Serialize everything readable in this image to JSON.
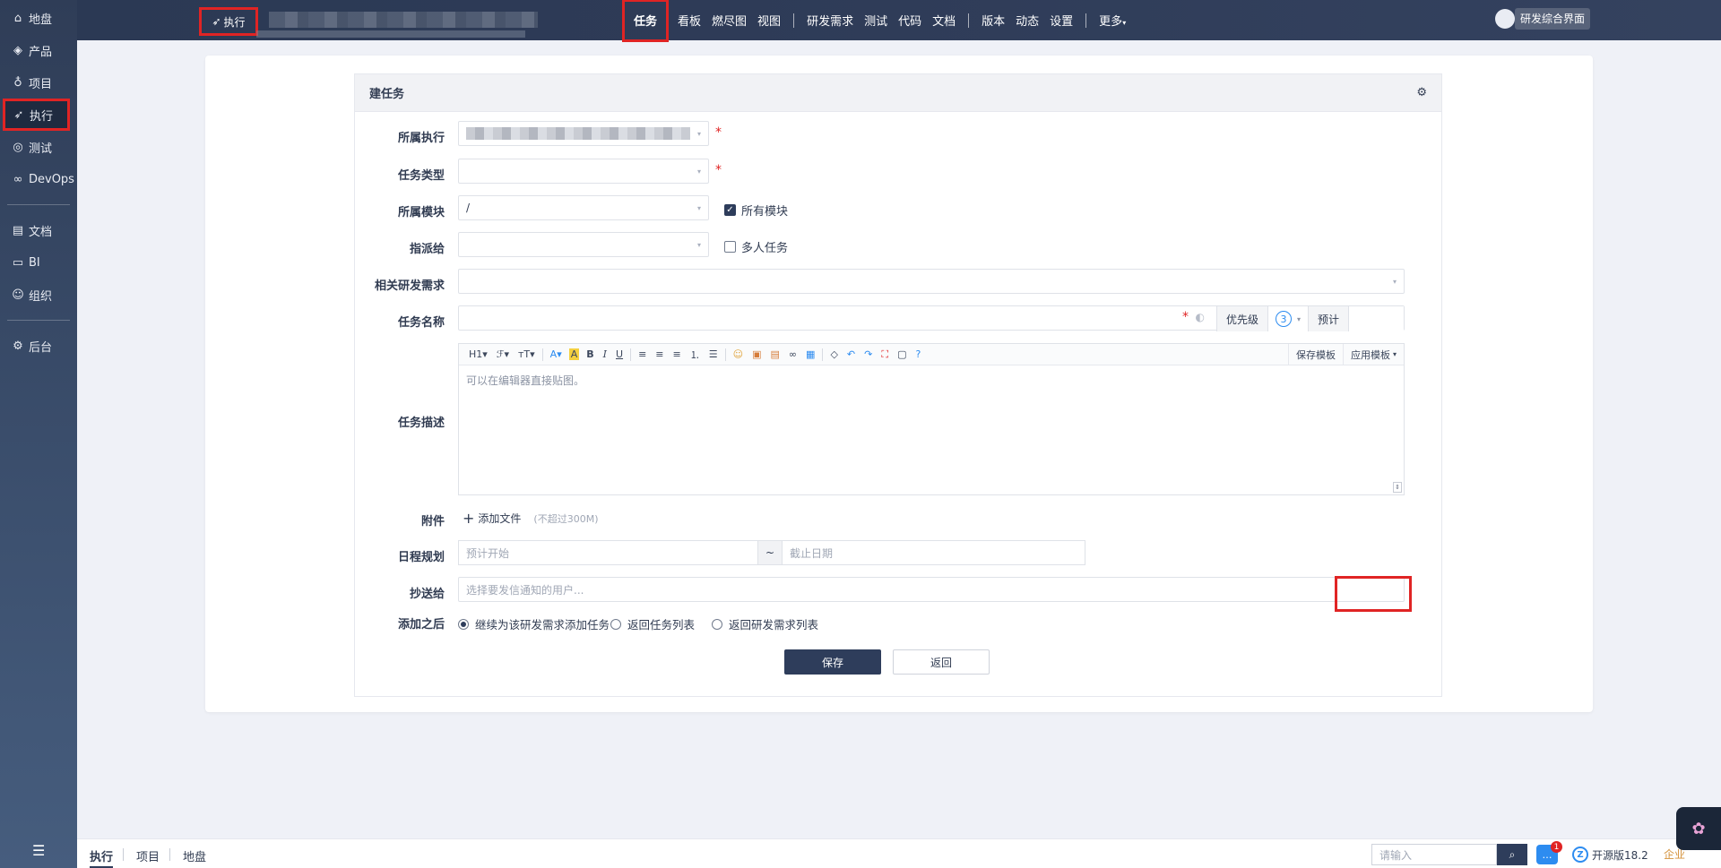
{
  "sidebar": {
    "items": [
      {
        "label": "地盘",
        "icon": "home-icon"
      },
      {
        "label": "产品",
        "icon": "product-icon"
      },
      {
        "label": "项目",
        "icon": "project-icon"
      },
      {
        "label": "执行",
        "icon": "run-icon"
      },
      {
        "label": "测试",
        "icon": "test-icon"
      },
      {
        "label": "DevOps",
        "icon": "devops-icon"
      },
      {
        "label": "文档",
        "icon": "doc-icon"
      },
      {
        "label": "BI",
        "icon": "bi-icon"
      },
      {
        "label": "组织",
        "icon": "org-icon"
      },
      {
        "label": "后台",
        "icon": "admin-icon"
      }
    ]
  },
  "header": {
    "breadcrumb": "执行",
    "nav": [
      "任务",
      "看板",
      "燃尽图",
      "视图",
      "研发需求",
      "测试",
      "代码",
      "文档",
      "版本",
      "动态",
      "设置",
      "更多"
    ],
    "switch_button": "研发综合界面"
  },
  "form": {
    "title": "建任务",
    "labels": {
      "execution": "所属执行",
      "type": "任务类型",
      "module": "所属模块",
      "assign": "指派给",
      "story": "相关研发需求",
      "name": "任务名称",
      "desc": "任务描述",
      "attach": "附件",
      "schedule": "日程规划",
      "cc": "抄送给",
      "after": "添加之后"
    },
    "module_value": "/",
    "all_modules": "所有模块",
    "multi_task": "多人任务",
    "priority_label": "优先级",
    "priority_value": "3",
    "estimate_label": "预计",
    "toolbar": {
      "h1": "H1",
      "font": "ℱ",
      "size": "тT",
      "save_template": "保存模板",
      "apply_template": "应用模板"
    },
    "editor_placeholder": "可以在编辑器直接贴图。",
    "add_file": "添加文件",
    "file_hint": "(不超过300M)",
    "date_start": "预计开始",
    "date_sep": "~",
    "date_end": "截止日期",
    "cc_placeholder": "选择要发信通知的用户...",
    "after_options": [
      "继续为该研发需求添加任务",
      "返回任务列表",
      "返回研发需求列表"
    ],
    "save": "保存",
    "back": "返回"
  },
  "footer": {
    "tabs": [
      "执行",
      "项目",
      "地盘"
    ],
    "search_placeholder": "请输入",
    "badge": "1",
    "version": "开源版18.2",
    "enterprise": "企业"
  }
}
